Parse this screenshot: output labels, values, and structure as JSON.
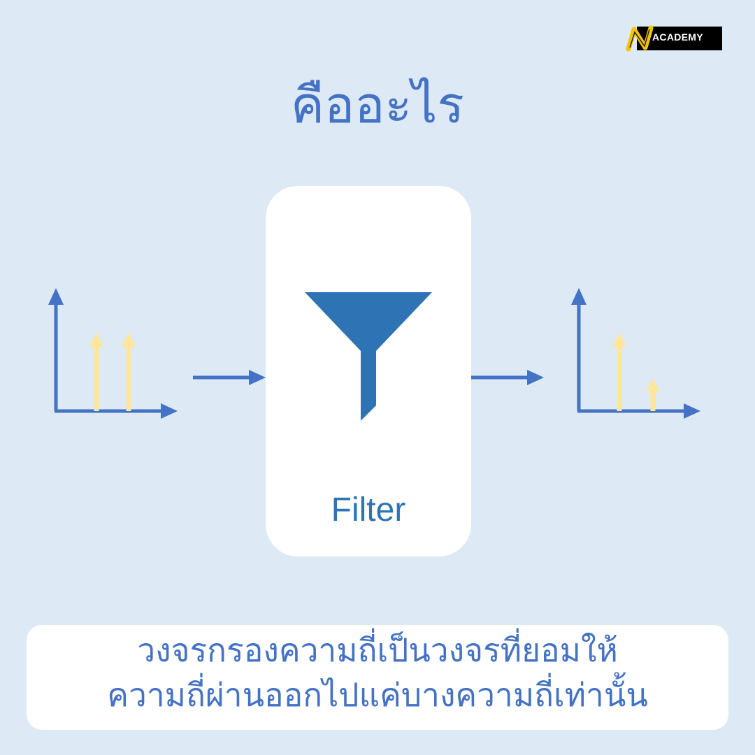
{
  "logo": {
    "text": "ACADEMY"
  },
  "title": "คืออะไร",
  "filter": {
    "label": "Filter",
    "icon": "funnel-icon"
  },
  "description": {
    "line1": "วงจรกรองความถี่เป็นวงจรที่ยอมให้",
    "line2": "ความถี่ผ่านออกไปแค่บางความถี่เท่านั้น"
  },
  "colors": {
    "background": "#dde9f5",
    "accent": "#4472c4",
    "funnel": "#2e74b5",
    "signal": "#ffe699"
  }
}
